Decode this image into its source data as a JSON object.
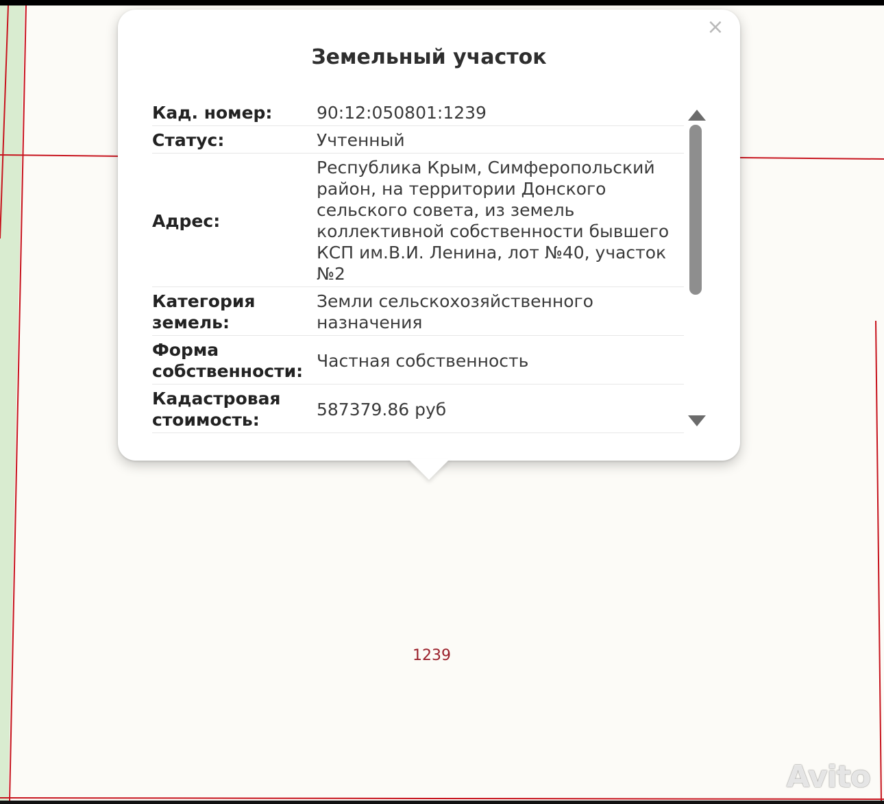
{
  "popup": {
    "title": "Земельный участок",
    "close_symbol": "×",
    "rows": [
      {
        "label": "Кад. номер:",
        "value": "90:12:050801:1239"
      },
      {
        "label": "Статус:",
        "value": "Учтенный"
      },
      {
        "label": "Адрес:",
        "value": "Республика Крым, Симферопольский район, на территории Донского сельского совета, из земель коллективной собственности бывшего КСП им.В.И. Ленина, лот №40, участок №2"
      },
      {
        "label": "Категория земель:",
        "value": "Земли сельскохозяйственного назначения"
      },
      {
        "label": "Форма собственности:",
        "value": "Частная собственность"
      },
      {
        "label": "Кадастровая стоимость:",
        "value": "587379.86 руб"
      }
    ],
    "scroll_icons": {
      "up": "scroll-up-arrow-icon",
      "down": "scroll-down-arrow-icon"
    }
  },
  "map": {
    "parcel_number": "1239",
    "watermark": "Avito",
    "colors": {
      "parcel_border": "#c7131d",
      "parcel_label": "#9a1f2a",
      "green_strip": "#d9ecd0",
      "background": "#fcfbf7"
    }
  }
}
